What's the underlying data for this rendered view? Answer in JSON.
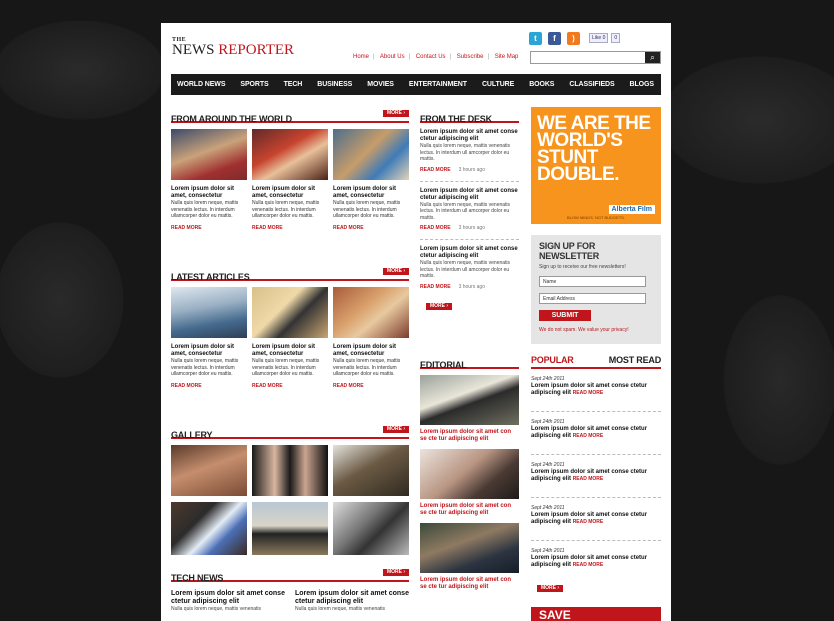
{
  "logo": {
    "the": "THE",
    "news": "NEWS",
    "reporter": " REPORTER"
  },
  "social": {
    "likebtn": "Like",
    "likecount": "0",
    "tweetcount": "0"
  },
  "toplinks": [
    "Home",
    "About Us",
    "Contact Us",
    "Subscribe",
    "Site Map"
  ],
  "nav": [
    "World News",
    "Sports",
    "Tech",
    "Business",
    "Movies",
    "Entertainment",
    "Culture",
    "Books",
    "Classifieds",
    "Blogs"
  ],
  "sections": {
    "world": {
      "title": "From Around the World",
      "more": "MORE ›"
    },
    "latest": {
      "title": "Latest Articles",
      "more": "MORE ›"
    },
    "gallery": {
      "title": "Gallery",
      "more": "MORE ›"
    },
    "tech": {
      "title": "Tech News",
      "more": "MORE ›"
    },
    "desk": {
      "title": "From the Desk"
    },
    "editorial": {
      "title": "Editorial"
    }
  },
  "card": {
    "headline": "Lorem ipsum dolor sit amet, consectetur",
    "body": "Nulla quis lorem neque, mattis venenatis lectus. In interdum ullamcorper dolor eu mattis.",
    "readmore": "READ MORE"
  },
  "desk": {
    "headline": "Lorem ipsum dolor sit amet conse ctetur adipiscing elit",
    "body": "Nulla quis lorem neque, mattis venenatis lectus. In interdum ull amcorper dolor eu mattis.",
    "readmore": "READ MORE",
    "time": "3 hours ago",
    "more": "MORE ›"
  },
  "editorial": {
    "caption": "Lorem ipsum dolor sit amet con se cte tur adipiscing elit"
  },
  "ad": {
    "line1": "WE ARE THE",
    "line2": "WORLD'S",
    "line3": "STUNT",
    "line4": "DOUBLE.",
    "brand": "Alberta Film",
    "tag": "BLOW MINDS. NOT BUDGETS."
  },
  "newsletter": {
    "title": "Sign up for Newsletter",
    "sub": "Sign up to receive our free newsletters!",
    "name": "Name",
    "email": "Email Address",
    "submit": "SUBMIT",
    "spam": "We do not spam. We value your privacy!"
  },
  "popular": {
    "left": "Popular",
    "right": "Most Read",
    "date": "Sept 24th 2011",
    "text": "Lorem ipsum dolor sit amet conse ctetur adipiscing elit",
    "readmore": "READ MORE",
    "more": "MORE ›"
  },
  "technews": {
    "headline": "Lorem ipsum dolor sit amet conse ctetur adipiscing elit",
    "body": "Nulla quis lorem neque, mattis venenatis"
  },
  "save": {
    "label": "SAVE"
  }
}
